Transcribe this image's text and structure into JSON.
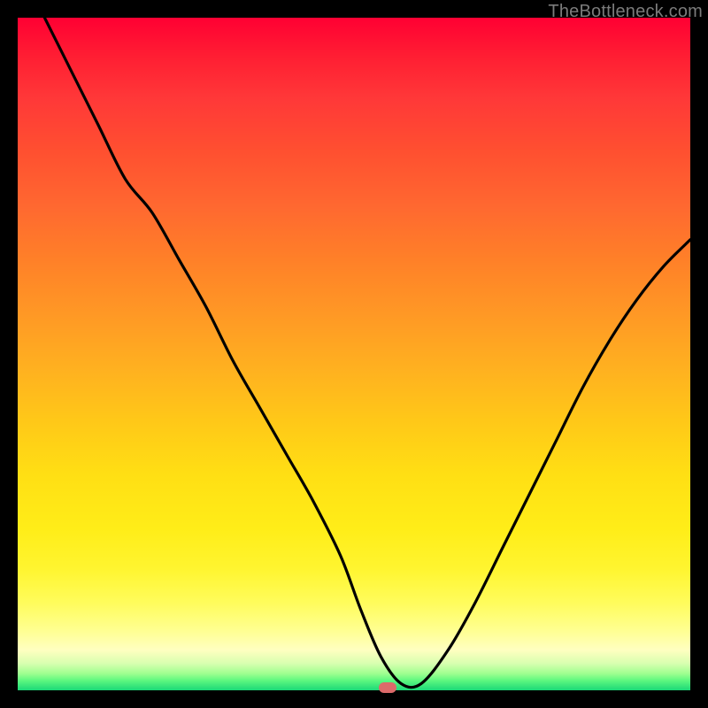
{
  "watermark": "TheBottleneck.com",
  "marker": {
    "x_pct": 55,
    "y_pct": 100
  },
  "chart_data": {
    "type": "line",
    "title": "",
    "xlabel": "",
    "ylabel": "",
    "xlim": [
      0,
      100
    ],
    "ylim": [
      0,
      100
    ],
    "series": [
      {
        "name": "bottleneck-curve",
        "x": [
          4,
          8,
          12,
          16,
          20,
          24,
          28,
          32,
          36,
          40,
          44,
          48,
          51,
          54,
          57,
          60,
          64,
          68,
          72,
          76,
          80,
          84,
          88,
          92,
          96,
          100
        ],
        "y": [
          100,
          92,
          84,
          76,
          71,
          64,
          57,
          49,
          42,
          35,
          28,
          20,
          12,
          5,
          1,
          1,
          6,
          13,
          21,
          29,
          37,
          45,
          52,
          58,
          63,
          67
        ]
      }
    ],
    "gradient_stops": [
      {
        "pct": 0,
        "color": "#ff0033"
      },
      {
        "pct": 50,
        "color": "#ffb020"
      },
      {
        "pct": 80,
        "color": "#ffed18"
      },
      {
        "pct": 100,
        "color": "#1bd877"
      }
    ]
  }
}
